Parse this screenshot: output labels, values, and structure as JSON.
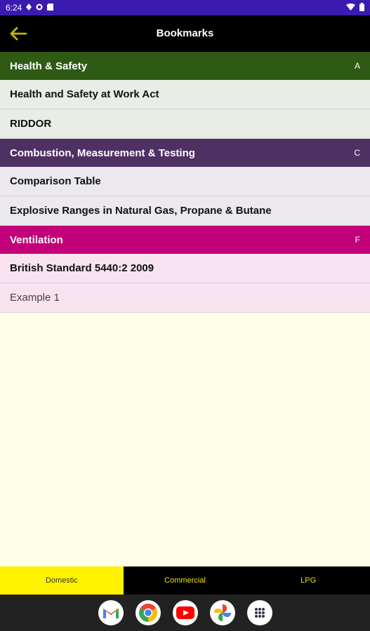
{
  "status_bar": {
    "time": "6:24",
    "icons": [
      "location-icon",
      "media-icon",
      "storage-icon",
      "wifi-icon",
      "battery-icon"
    ]
  },
  "app_bar": {
    "title": "Bookmarks",
    "back_icon": "arrow-left-icon",
    "back_color": "#c8b400"
  },
  "sections": [
    {
      "title": "Health & Safety",
      "letter": "A",
      "header_color": "#2e5a14",
      "row_color": "#e8ede6",
      "items": [
        "Health and Safety at Work Act",
        "RIDDOR"
      ]
    },
    {
      "title": "Combustion, Measurement & Testing",
      "letter": "C",
      "header_color": "#4e3162",
      "row_color": "#ebe8ee",
      "items": [
        "Comparison Table",
        "Explosive Ranges in Natural Gas, Propane & Butane"
      ]
    },
    {
      "title": "Ventilation",
      "letter": "F",
      "header_color": "#c2007a",
      "row_color": "#f8e2ef",
      "items": [
        "British Standard 5440:2 2009",
        "Example 1"
      ]
    }
  ],
  "tabs": {
    "domestic": "Domestic",
    "commercial": "Commercial",
    "lpg": "LPG",
    "active": "Domestic"
  },
  "dock_apps": [
    "gmail-icon",
    "chrome-icon",
    "youtube-icon",
    "photos-icon",
    "app-drawer-icon"
  ]
}
